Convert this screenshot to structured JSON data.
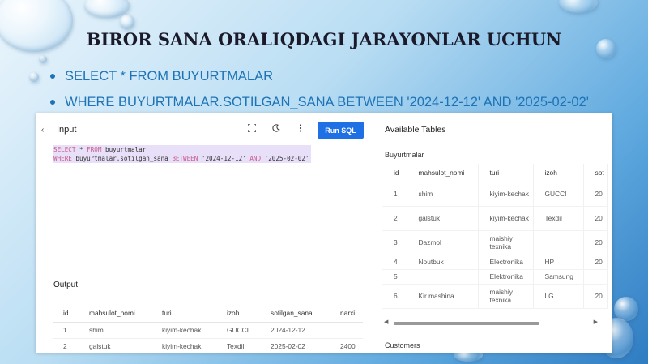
{
  "slide": {
    "title": "BIROR SANA ORALIQDAGI JARAYONLAR UCHUN",
    "bullets": [
      "SELECT * FROM BUYURTMALAR",
      "WHERE BUYURTMALAR.SOTILGAN_SANA BETWEEN '2024-12-12' AND '2025-02-02'"
    ]
  },
  "editor": {
    "collapse_icon": "‹",
    "input_title": "Input",
    "toolbar_icons": [
      "fullscreen-icon",
      "theme-moon-icon",
      "more-vertical-icon"
    ],
    "run_label": "Run SQL",
    "code": {
      "line1_kw1": "SELECT",
      "line1_rest1": " * ",
      "line1_kw2": "FROM",
      "line1_rest2": " buyurtmalar",
      "line2_kw1": "WHERE",
      "line2_rest1": " buyurtmalar.sotilgan_sana ",
      "line2_kw2": "BETWEEN",
      "line2_rest2": " '2024-12-12' ",
      "line2_kw3": "AND",
      "line2_rest3": " '2025-02-02'"
    }
  },
  "output": {
    "title": "Output",
    "columns": [
      "id",
      "mahsulot_nomi",
      "turi",
      "izoh",
      "sotilgan_sana",
      "narxi"
    ],
    "rows": [
      [
        "1",
        "shim",
        "kiyim-kechak",
        "GUCCI",
        "2024-12-12",
        ""
      ],
      [
        "2",
        "galstuk",
        "kiyim-kechak",
        "Texdil",
        "2025-02-02",
        "2400"
      ]
    ]
  },
  "available": {
    "title": "Available Tables",
    "table_name": "Buyurtmalar",
    "columns": [
      "id",
      "mahsulot_nomi",
      "turi",
      "izoh",
      "sot"
    ],
    "rows": [
      [
        "1",
        "shim",
        "kiyim-kechak",
        "GUCCI",
        "20"
      ],
      [
        "2",
        "galstuk",
        "kiyim-kechak",
        "Texdil",
        "20"
      ],
      [
        "3",
        "Dazmol",
        "maishiy texnika",
        "",
        "20"
      ],
      [
        "4",
        "Noutbuk",
        "Electronika",
        "HP",
        "20"
      ],
      [
        "5",
        "",
        "Elektronika",
        "Samsung",
        ""
      ],
      [
        "6",
        "Kir mashina",
        "maishiy texnika",
        "LG",
        "20"
      ]
    ],
    "next_table": "Customers"
  }
}
